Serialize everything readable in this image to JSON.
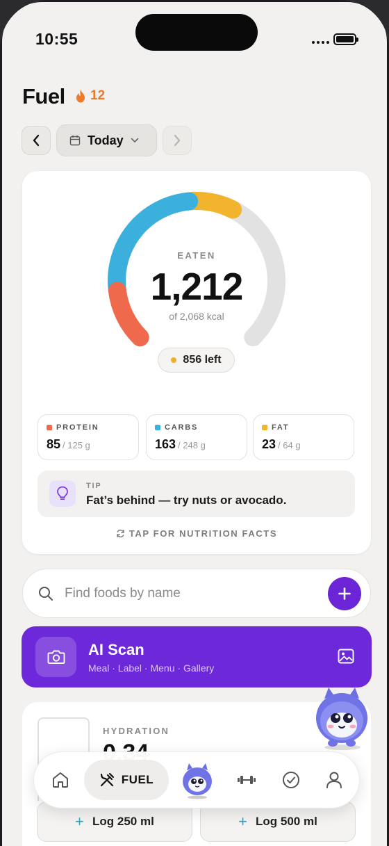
{
  "status_bar": {
    "time": "10:55"
  },
  "header": {
    "title": "Fuel",
    "streak_count": "12",
    "date_label": "Today"
  },
  "summary": {
    "eaten_label": "EATEN",
    "eaten_value": "1,212",
    "goal_text": "of 2,068 kcal",
    "left_text": "856 left",
    "gauge_segments": [
      {
        "name": "protein",
        "fraction": 0.14,
        "color": "#ef6a4c"
      },
      {
        "name": "carbs",
        "fraction": 0.34,
        "color": "#3cb0dc"
      },
      {
        "name": "fat",
        "fraction": 0.12,
        "color": "#f2b42c"
      }
    ],
    "gauge_track_color": "#e2e2e2"
  },
  "macros": [
    {
      "name": "PROTEIN",
      "value": "85",
      "goal": "/ 125 g",
      "color": "#ef6a4c"
    },
    {
      "name": "CARBS",
      "value": "163",
      "goal": "/ 248 g",
      "color": "#3cb0dc"
    },
    {
      "name": "FAT",
      "value": "23",
      "goal": "/ 64 g",
      "color": "#f2b42c"
    }
  ],
  "tip": {
    "label": "TIP",
    "text": "Fat’s behind — try nuts or avocado."
  },
  "nutrition_facts_link": "TAP FOR NUTRITION FACTS",
  "search": {
    "placeholder": "Find foods by name"
  },
  "ai_scan": {
    "title": "AI Scan",
    "subtitle": "Meal · Label · Menu · Gallery",
    "color": "#6d28d9"
  },
  "hydration": {
    "label": "HYDRATION",
    "value": "0.34",
    "buttons": [
      {
        "label": "Log 250 ml"
      },
      {
        "label": "Log 500 ml"
      }
    ]
  },
  "tabbar": {
    "active_label": "FUEL"
  },
  "colors": {
    "accent": "#6b25d6",
    "streak": "#ea7a2c",
    "background": "#f2f1ef"
  }
}
